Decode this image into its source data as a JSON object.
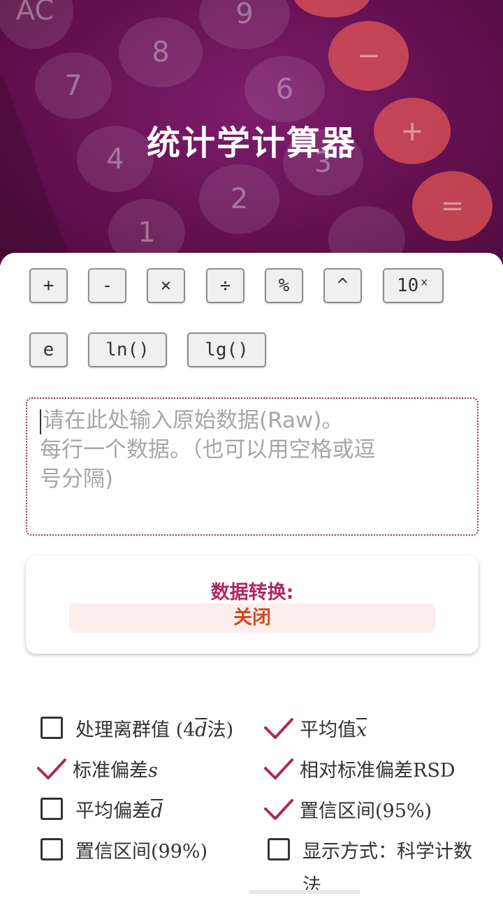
{
  "header": {
    "title": "统计学计算器",
    "deco_keys": [
      "AC",
      "9",
      "8",
      "7",
      "6",
      "4",
      "3",
      "2",
      "1"
    ],
    "deco_ops": [
      "−",
      "+",
      "="
    ]
  },
  "operators": [
    "+",
    "-",
    "×",
    "÷",
    "%",
    "^",
    "10ˣ",
    "e",
    "ln()",
    "lg()"
  ],
  "input": {
    "placeholder_line1": "请在此处输入原始数据(Raw)。",
    "placeholder_line2": "每行一个数据。（也可以用空格或逗",
    "placeholder_line3": "号分隔)"
  },
  "conversion": {
    "label": "数据转换:",
    "state": "关闭"
  },
  "options": {
    "outliers": {
      "label": "处理离群值 (4",
      "symbol": "d",
      "suffix": "法)",
      "checked": false
    },
    "mean": {
      "label": "平均值",
      "symbol": "x",
      "checked": true
    },
    "std": {
      "label": "标准偏差",
      "symbol": "s",
      "checked": true
    },
    "rsd": {
      "label": "相对标准偏差RSD",
      "checked": true
    },
    "avg_dev": {
      "label": "平均偏差",
      "symbol": "d",
      "checked": false
    },
    "ci95": {
      "label": "置信区间(95%)",
      "checked": true
    },
    "ci99": {
      "label": "置信区间(99%)",
      "checked": false
    },
    "display": {
      "label_line1": "显示方式：科学计数",
      "label_line2": "法",
      "checked": false
    }
  },
  "colors": {
    "header": "#63104f",
    "accent": "#b0275e",
    "state": "#d24a1c"
  }
}
